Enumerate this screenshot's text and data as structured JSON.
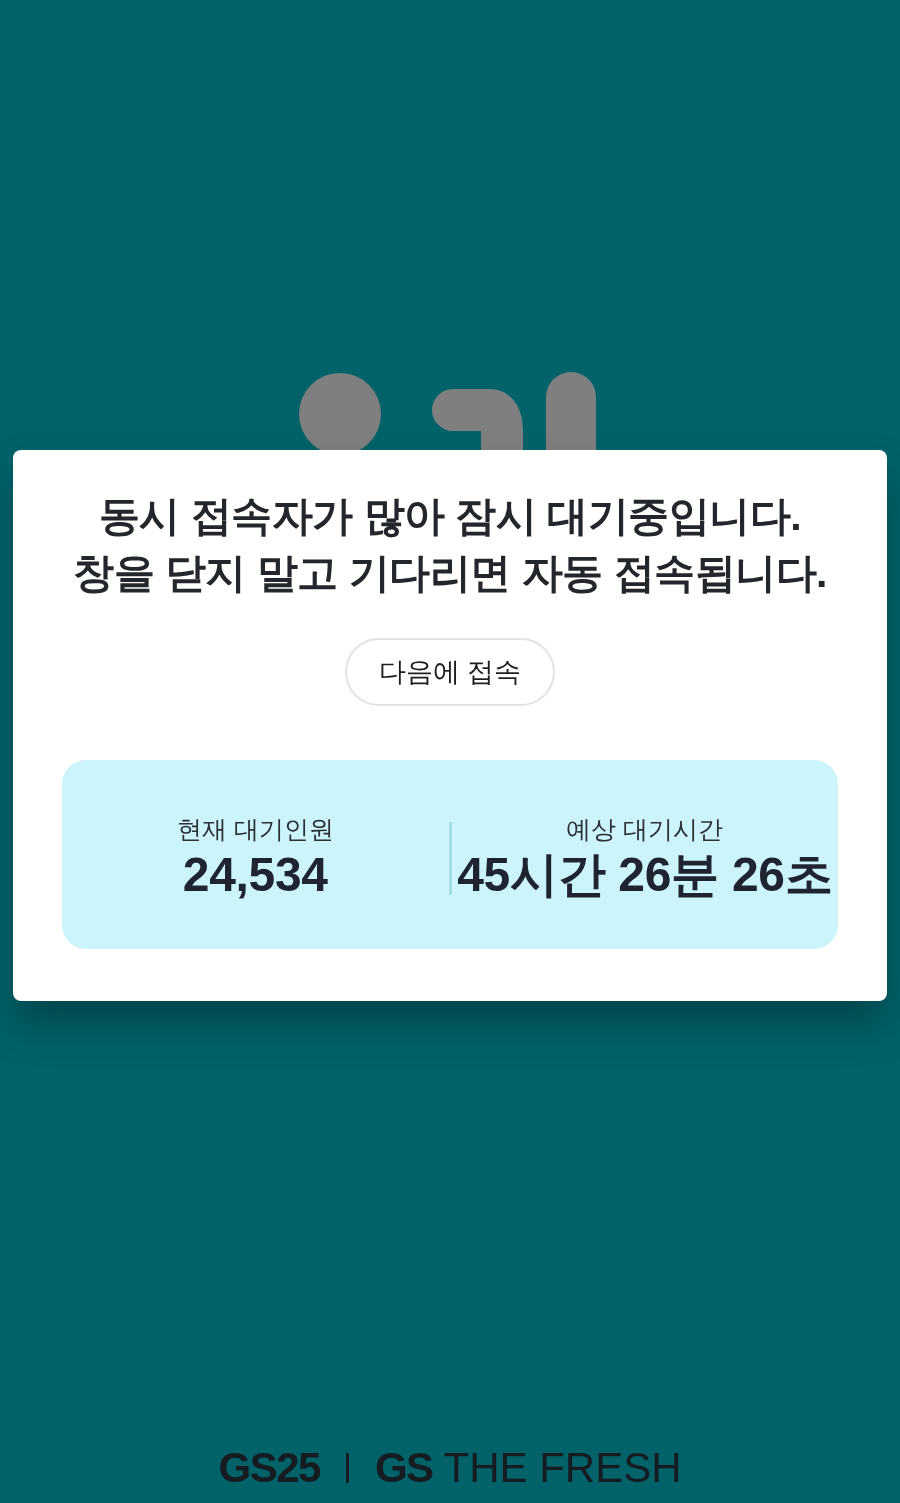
{
  "notice": {
    "lines": [
      "동시 접속자가 많아 잠시 대기중입니다.",
      "창을 닫지 말고 기다리면 자동 접속됩니다."
    ]
  },
  "button": {
    "label": "다음에 접속"
  },
  "stats": [
    {
      "label": "현재 대기인원",
      "value": "24,534"
    },
    {
      "label": "예상 대기시간",
      "value": "45시간 26분 26초"
    }
  ],
  "footer": {
    "logos": [
      "GS25",
      "**GS** THE FRESH"
    ]
  }
}
